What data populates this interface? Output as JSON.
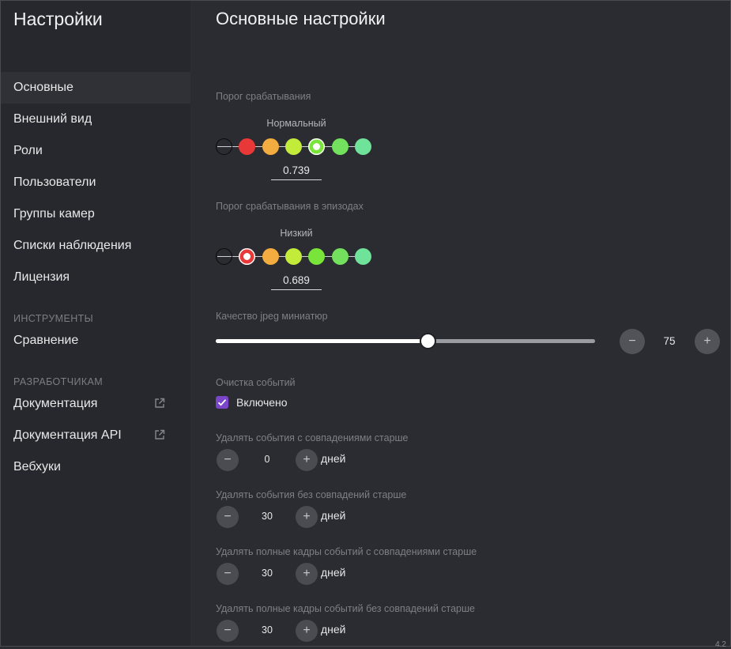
{
  "sidebar": {
    "title": "Настройки",
    "items": [
      {
        "label": "Основные"
      },
      {
        "label": "Внешний вид"
      },
      {
        "label": "Роли"
      },
      {
        "label": "Пользователи"
      },
      {
        "label": "Группы камер"
      },
      {
        "label": "Списки наблюдения"
      },
      {
        "label": "Лицензия"
      }
    ],
    "tools_section": "ИНСТРУМЕНТЫ",
    "tools_items": [
      {
        "label": "Сравнение"
      }
    ],
    "dev_section": "РАЗРАБОТЧИКАМ",
    "dev_items": [
      {
        "label": "Документация",
        "icon": "external-link-icon"
      },
      {
        "label": "Документация API",
        "icon": "external-link-icon"
      },
      {
        "label": "Вебхуки"
      }
    ]
  },
  "main": {
    "title": "Основные настройки",
    "threshold": {
      "label": "Порог срабатывания",
      "level": "Нормальный",
      "value": "0.739",
      "selected_index": 3,
      "colors": [
        "#e93838",
        "#f2ac40",
        "#c3ec3a",
        "#79e53a",
        "#73e15d",
        "#6fe39a"
      ]
    },
    "episode_threshold": {
      "label": "Порог срабатывания в эпизодах",
      "level": "Низкий",
      "value": "0.689",
      "selected_index": 0,
      "colors": [
        "#e93838",
        "#f2ac40",
        "#c3ec3a",
        "#79e53a",
        "#73e15d",
        "#6fe39a"
      ]
    },
    "jpeg_quality": {
      "label": "Качество jpeg миниатюр",
      "value": "75",
      "fraction": 0.558,
      "minus": "−",
      "plus": "+"
    },
    "cleanup": {
      "label": "Очистка событий",
      "checkbox_label": "Включено",
      "enabled": true
    },
    "retention": [
      {
        "label": "Удалять события с совпадениями старше",
        "value": "0",
        "unit": "дней",
        "minus": "−",
        "plus": "+"
      },
      {
        "label": "Удалять события без совпадений старше",
        "value": "30",
        "unit": "дней",
        "minus": "−",
        "plus": "+"
      },
      {
        "label": "Удалять полные кадры событий с совпадениями старше",
        "value": "30",
        "unit": "дней",
        "minus": "−",
        "plus": "+"
      },
      {
        "label": "Удалять полные кадры событий без совпадений старше",
        "value": "30",
        "unit": "дней",
        "minus": "−",
        "plus": "+"
      }
    ]
  },
  "corner_text": "4.2"
}
